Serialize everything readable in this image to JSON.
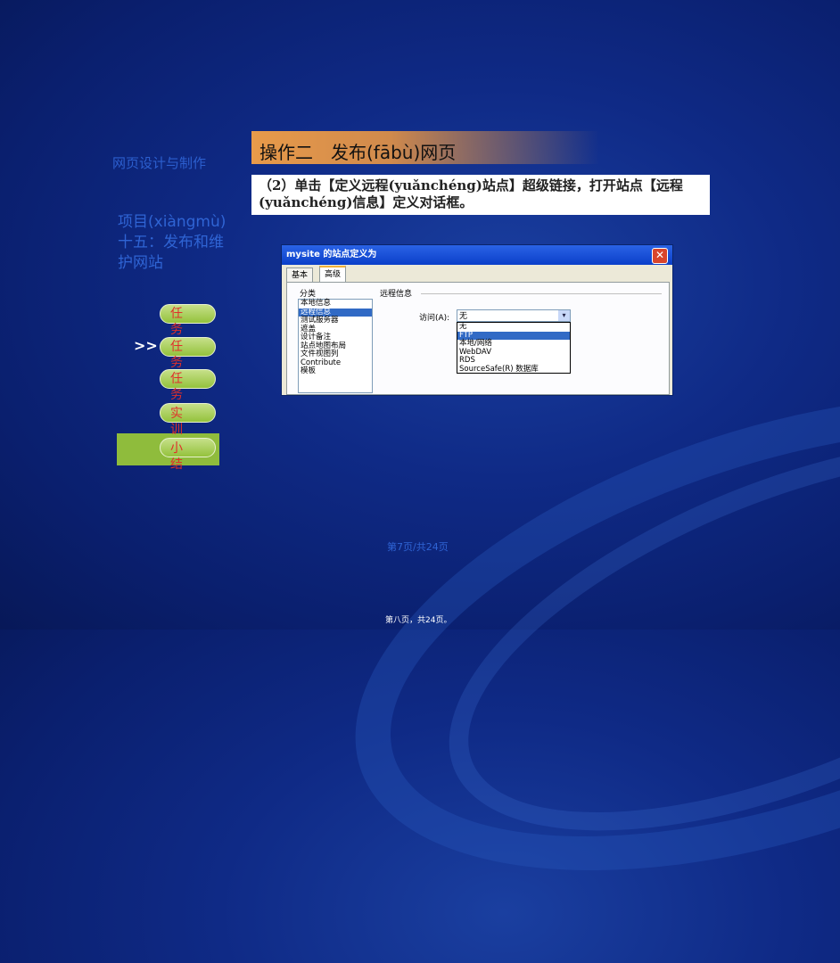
{
  "sidebar": {
    "course_title": "网页设计与制作",
    "project_title": "项目(xiàngmù)十五：发布和维护网站",
    "arrow": ">>",
    "nav_items": [
      {
        "label": "任务一"
      },
      {
        "label": "任务二"
      },
      {
        "label": "任务三"
      },
      {
        "label": "实训"
      },
      {
        "label": "小结"
      }
    ]
  },
  "main": {
    "operation_title": "操作二　发布(fābù)网页",
    "instruction": "（2）单击【定义远程(yuǎnchéng)站点】超级链接，打开站点【远程(yuǎnchéng)信息】定义对话框。"
  },
  "dialog": {
    "title": "mysite 的站点定义为",
    "close_glyph": "✕",
    "tabs": [
      "基本",
      "高级"
    ],
    "active_tab": "高级",
    "category_label": "分类",
    "categories": [
      "本地信息",
      "远程信息",
      "测试服务器",
      "遮盖",
      "设计备注",
      "站点地图布局",
      "文件视图列",
      "Contribute",
      "模板"
    ],
    "selected_category": "远程信息",
    "section_label": "远程信息",
    "access_label": "访问(A):",
    "access_value": "无",
    "dropdown_glyph": "▾",
    "dropdown_options": [
      "无",
      "FTP",
      "本地/网络",
      "WebDAV",
      "RDS",
      "SourceSafe(R) 数据库"
    ],
    "highlighted_option": "FTP"
  },
  "footer": {
    "page_counter": "第7页/共24页",
    "bottom_note": "第八页，共24页。"
  }
}
